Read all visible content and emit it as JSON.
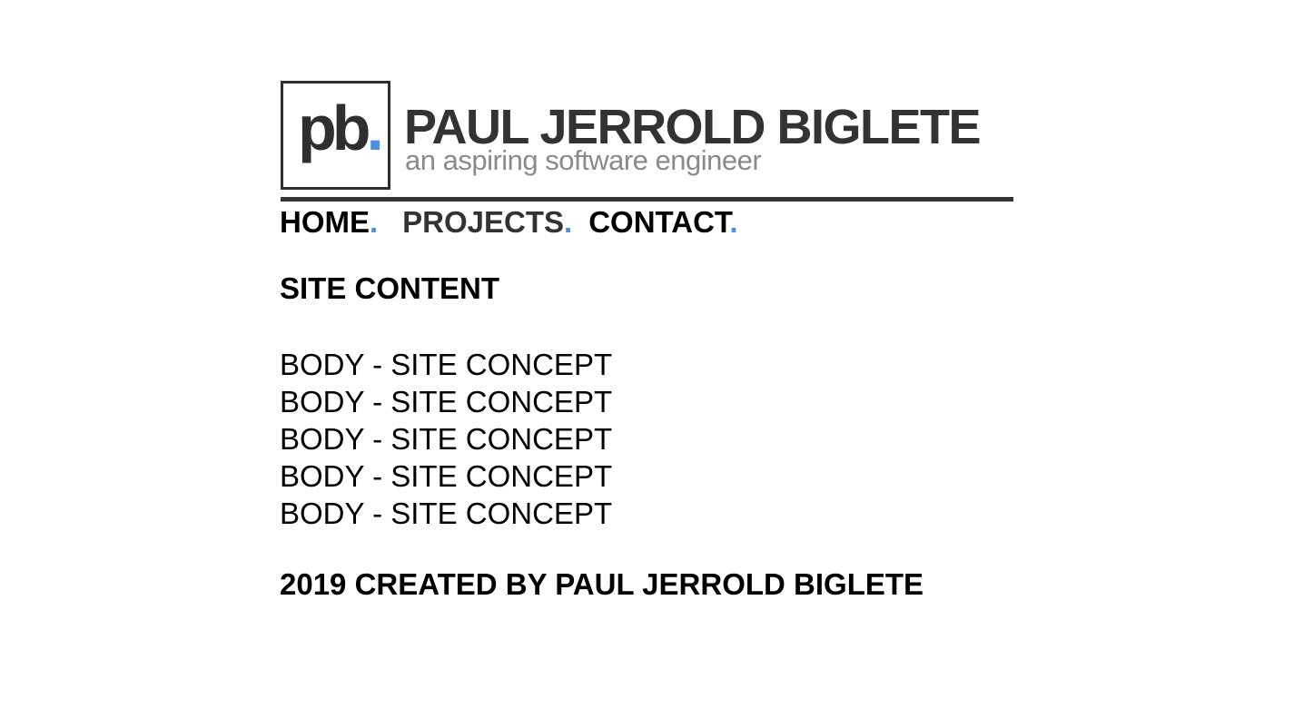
{
  "header": {
    "logo": {
      "letters": "pb",
      "dot": "."
    },
    "site_name": "PAUL JERROLD BIGLETE",
    "tagline": "an aspiring software engineer"
  },
  "nav": {
    "items": [
      {
        "label": "HOME",
        "dot": "."
      },
      {
        "label": "PROJECTS",
        "dot": "."
      },
      {
        "label": "CONTACT",
        "dot": "."
      }
    ]
  },
  "main": {
    "section_title": "SITE CONTENT",
    "body_lines": [
      "BODY - SITE CONCEPT",
      "BODY - SITE CONCEPT",
      "BODY - SITE CONCEPT",
      "BODY - SITE CONCEPT",
      "BODY - SITE CONCEPT"
    ]
  },
  "footer": {
    "text": "2019 CREATED BY PAUL JERROLD BIGLETE"
  },
  "colors": {
    "accent": "#4a90e2",
    "dark": "#333333",
    "muted": "#8a8a8a"
  }
}
